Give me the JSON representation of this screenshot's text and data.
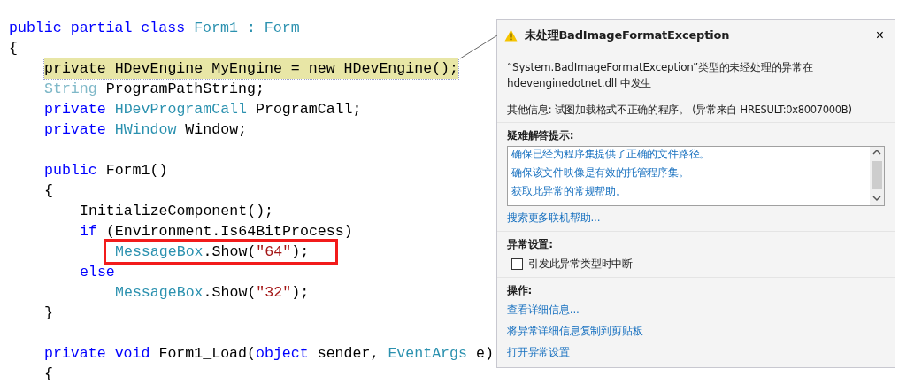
{
  "code": {
    "lines": [
      {
        "tokens": [
          {
            "kind": "keyword",
            "text": "public partial class"
          },
          {
            "kind": "type",
            "text": "Form1"
          },
          {
            "kind": "type",
            "text": ":"
          },
          {
            "kind": "type",
            "text": "Form"
          }
        ]
      },
      {
        "tokens": [
          {
            "kind": "plain",
            "text": "{"
          }
        ],
        "children": [
          {
            "highlighted": true,
            "error_mark": true,
            "tokens": [
              {
                "kind": "plain",
                "text": "private HDevEngine MyEngine = new HDevEngine();"
              }
            ]
          },
          {
            "tokens": [
              {
                "kind": "faded",
                "text": "String"
              },
              {
                "kind": "plain",
                "text": "ProgramPathString;"
              }
            ]
          },
          {
            "tokens": [
              {
                "kind": "keyword",
                "text": "private"
              },
              {
                "kind": "type",
                "text": "HDevProgramCall"
              },
              {
                "kind": "plain",
                "text": "ProgramCall;"
              }
            ]
          },
          {
            "tokens": [
              {
                "kind": "keyword",
                "text": "private"
              },
              {
                "kind": "type",
                "text": "HWindow"
              },
              {
                "kind": "plain",
                "text": "Window;"
              }
            ]
          },
          {
            "gap_before": true,
            "tokens": [
              {
                "kind": "keyword",
                "text": "public"
              },
              {
                "kind": "plain",
                "text": "Form1()"
              }
            ]
          },
          {
            "tokens": [
              {
                "kind": "plain",
                "text": "{"
              }
            ],
            "children": [
              {
                "tokens": [
                  {
                    "kind": "plain",
                    "text": "InitializeComponent();"
                  }
                ]
              },
              {
                "tokens": [
                  {
                    "kind": "keyword",
                    "text": "if"
                  },
                  {
                    "kind": "plain",
                    "text": "(Environment.Is64BitProcess)"
                  }
                ],
                "children": [
                  {
                    "boxed": true,
                    "tokens": [
                      {
                        "kind": "type",
                        "text": "MessageBox"
                      },
                      {
                        "kind": "plain",
                        "text": ".Show(",
                        "glue": true
                      },
                      {
                        "kind": "string",
                        "text": "\"64\"",
                        "glue": true
                      },
                      {
                        "kind": "plain",
                        "text": ");",
                        "glue": true
                      }
                    ]
                  }
                ]
              },
              {
                "tokens": [
                  {
                    "kind": "keyword",
                    "text": "else"
                  }
                ],
                "children": [
                  {
                    "tokens": [
                      {
                        "kind": "type",
                        "text": "MessageBox"
                      },
                      {
                        "kind": "plain",
                        "text": ".Show(",
                        "glue": true
                      },
                      {
                        "kind": "string",
                        "text": "\"32\"",
                        "glue": true
                      },
                      {
                        "kind": "plain",
                        "text": ");",
                        "glue": true
                      }
                    ]
                  }
                ]
              }
            ]
          },
          {
            "tokens": [
              {
                "kind": "plain",
                "text": "}"
              }
            ]
          },
          {
            "gap_before": true,
            "tokens": [
              {
                "kind": "keyword",
                "text": "private void"
              },
              {
                "kind": "plain",
                "text": "Form1_Load("
              },
              {
                "kind": "keyword",
                "text": "object",
                "glue": true
              },
              {
                "kind": "plain",
                "text": "sender,"
              },
              {
                "kind": "type",
                "text": "EventArgs"
              },
              {
                "kind": "plain",
                "text": "e)"
              }
            ]
          },
          {
            "tokens": [
              {
                "kind": "plain",
                "text": "{"
              }
            ]
          }
        ]
      }
    ]
  },
  "exception_dialog": {
    "title": "未处理BadImageFormatException",
    "close": "×",
    "message": "“System.BadImageFormatException”类型的未经处理的异常在 hdevenginedotnet.dll 中发生",
    "additional_info": "其他信息: 试图加载格式不正确的程序。 (异常来自 HRESULT:0x8007000B)",
    "troubleshooting": {
      "heading": "疑难解答提示:",
      "tips": [
        "确保已经为程序集提供了正确的文件路径。",
        "确保该文件映像是有效的托管程序集。",
        "获取此异常的常规帮助。"
      ],
      "more_link": "搜索更多联机帮助..."
    },
    "settings": {
      "heading": "异常设置:",
      "checkbox": {
        "label": "引发此异常类型时中断",
        "checked": false
      }
    },
    "actions": {
      "heading": "操作:",
      "links": [
        "查看详细信息...",
        "将异常详细信息复制到剪贴板",
        "打开异常设置"
      ]
    }
  }
}
